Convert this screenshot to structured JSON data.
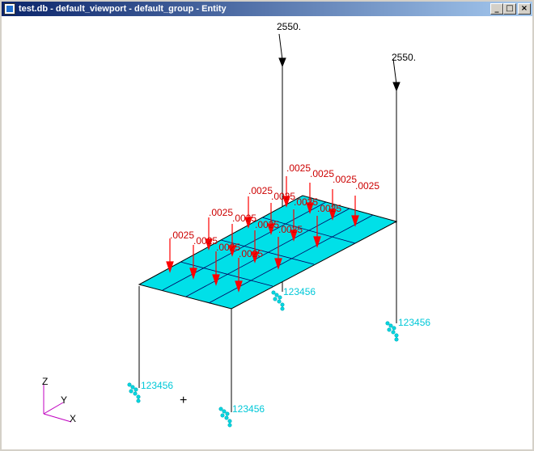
{
  "window": {
    "title": "test.db - default_viewport - default_group - Entity",
    "minimize_glyph": "_",
    "maximize_glyph": "□",
    "close_glyph": "×"
  },
  "viewport": {
    "colors": {
      "plate_fill": "#00e0e8",
      "mesh_lines": "#000080",
      "pressure_arrows": "#ff0000",
      "constraint": "#00d8e0",
      "axis_z": "#c000c0",
      "axis_x": "#c000c0",
      "axis_y": "#c000c0"
    },
    "pressure_labels": [
      ".0025",
      ".0025",
      ".0025",
      ".0025",
      ".0025",
      ".0025",
      ".0025",
      ".0025",
      ".0025",
      ".0025",
      ".0025",
      ".0025",
      ".0025",
      ".0025",
      ".0025",
      ".0025"
    ],
    "force_labels": [
      "2550.",
      "2550."
    ],
    "constraint_labels": [
      "123456",
      "123456",
      "123456",
      "123456"
    ],
    "axis_labels": {
      "z": "Z",
      "y": "Y",
      "x": "X"
    },
    "origin_marker": "+"
  }
}
